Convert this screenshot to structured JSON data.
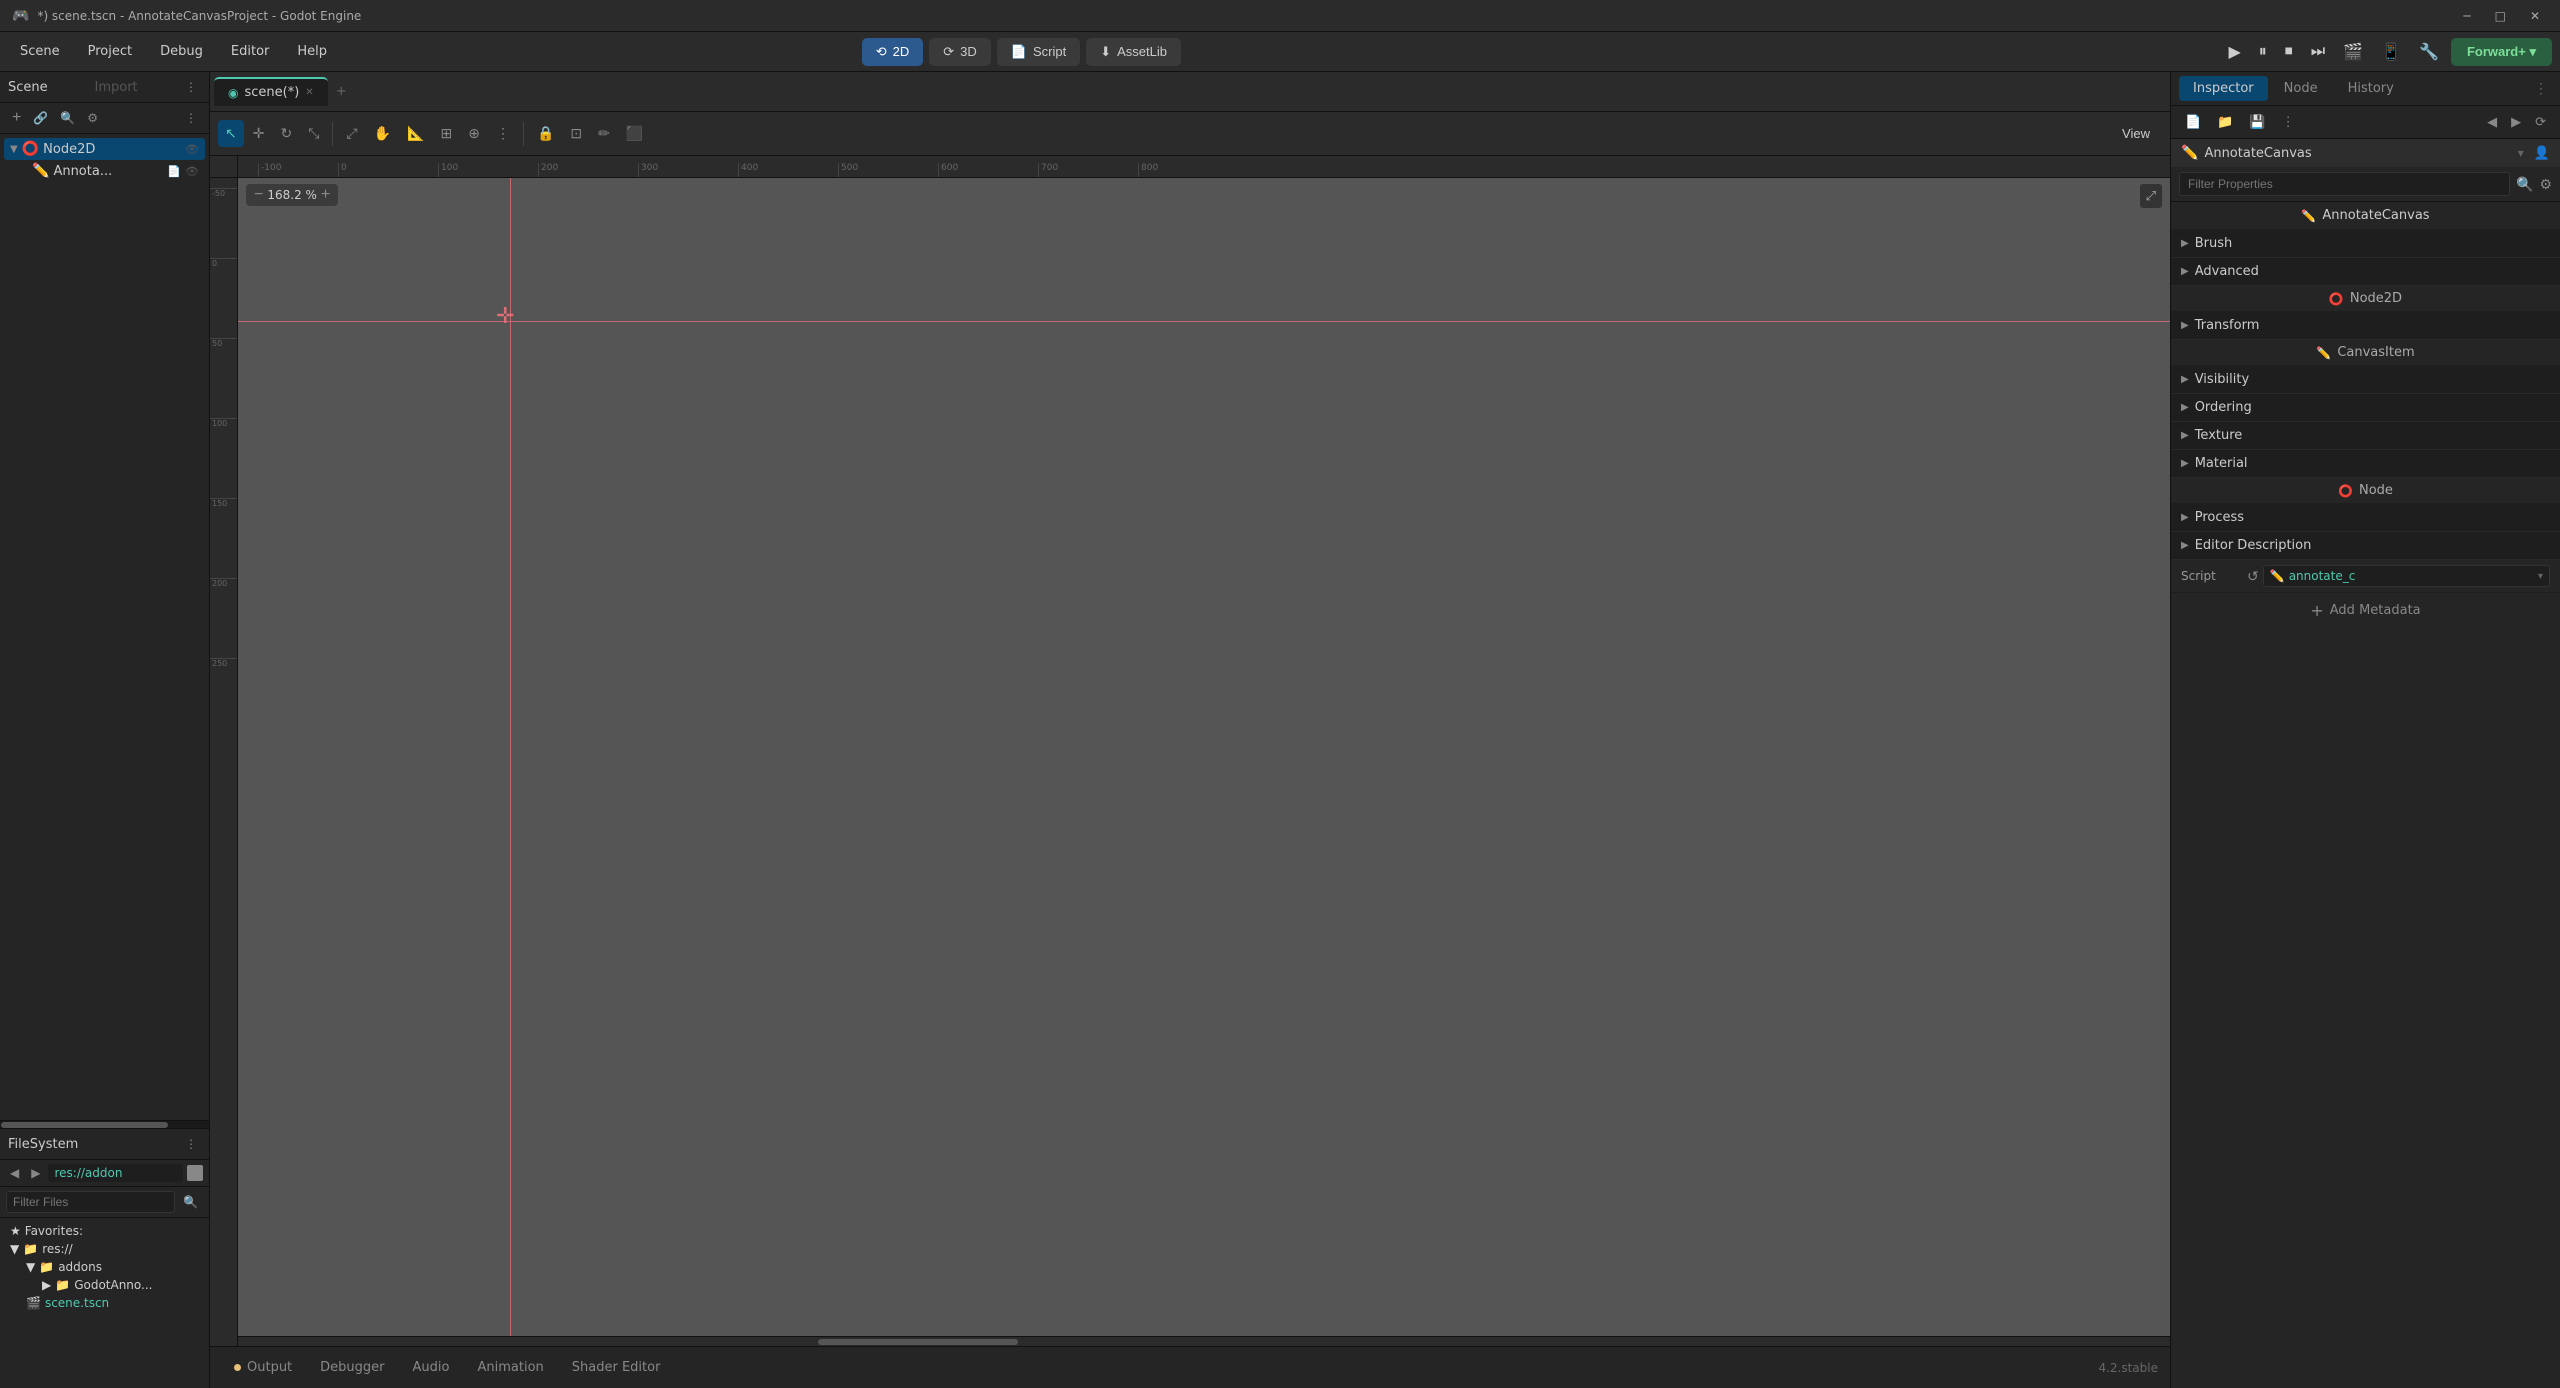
{
  "window": {
    "title": "*) scene.tscn - AnnotateCanvasProject - Godot Engine"
  },
  "menu": {
    "items": [
      "Scene",
      "Project",
      "Debug",
      "Editor",
      "Help"
    ]
  },
  "toolbar": {
    "mode_2d": "2D",
    "mode_3d": "3D",
    "script": "Script",
    "asset_lib": "AssetLib",
    "forward_label": "Forward+"
  },
  "editor_tabs": [
    {
      "label": "scene(*)",
      "active": true
    }
  ],
  "editor_toolbar_buttons": [
    "select",
    "move",
    "rotate",
    "scale",
    "move2",
    "grab",
    "scissors",
    "anchor",
    "snap",
    "lock",
    "frame",
    "pencil",
    "erase"
  ],
  "view_button": "View",
  "zoom": {
    "value": "168.2 %"
  },
  "left_panel": {
    "scene_label": "Scene",
    "import_label": "Import",
    "tree": [
      {
        "label": "Node2D",
        "icon": "⭕",
        "children": [
          {
            "label": "Annota...",
            "icon": "✏️"
          }
        ]
      }
    ]
  },
  "filesystem": {
    "title": "FileSystem",
    "path": "res://addon",
    "filter_placeholder": "Filter Files",
    "tree": [
      {
        "label": "Favorites:",
        "icon": "★",
        "type": "favorites"
      },
      {
        "label": "res://",
        "icon": "📁",
        "expanded": true,
        "children": [
          {
            "label": "addons",
            "icon": "📁",
            "expanded": true,
            "children": [
              {
                "label": "GodotAnno...",
                "icon": "📁"
              }
            ]
          },
          {
            "label": "scene.tscn",
            "icon": "🎬",
            "highlight": true
          }
        ]
      }
    ]
  },
  "bottom_tabs": [
    {
      "label": "Output",
      "has_dot": true
    },
    {
      "label": "Debugger",
      "has_dot": false
    },
    {
      "label": "Audio",
      "has_dot": false
    },
    {
      "label": "Animation",
      "has_dot": false
    },
    {
      "label": "Shader Editor",
      "has_dot": false
    }
  ],
  "version": "4.2.stable",
  "inspector": {
    "title": "Inspector",
    "tabs": [
      "Inspector",
      "Node",
      "History"
    ],
    "active_tab": "Inspector",
    "node_name": "AnnotateCanvas",
    "filter_placeholder": "Filter Properties",
    "sections": [
      {
        "type": "class-header",
        "label": "AnnotateCanvas",
        "icon": "✏️"
      },
      {
        "type": "section",
        "label": "Brush",
        "expanded": true
      },
      {
        "type": "section",
        "label": "Advanced",
        "expanded": true
      },
      {
        "type": "node-header",
        "label": "Node2D",
        "icon": "⭕"
      },
      {
        "type": "section",
        "label": "Transform",
        "expanded": true
      },
      {
        "type": "canvas-item-header",
        "label": "CanvasItem",
        "icon": "✏️"
      },
      {
        "type": "section",
        "label": "Visibility",
        "expanded": true
      },
      {
        "type": "section",
        "label": "Ordering",
        "expanded": true
      },
      {
        "type": "section",
        "label": "Texture",
        "expanded": true
      },
      {
        "type": "section",
        "label": "Material",
        "expanded": true
      },
      {
        "type": "node-header2",
        "label": "Node",
        "icon": "⭕"
      },
      {
        "type": "section",
        "label": "Process",
        "expanded": true
      },
      {
        "type": "section",
        "label": "Editor Description",
        "expanded": true
      }
    ],
    "script_label": "Script",
    "script_reset_icon": "↺",
    "script_icon": "✏️",
    "script_name": "annotate_c",
    "add_metadata_label": "Add Metadata"
  }
}
